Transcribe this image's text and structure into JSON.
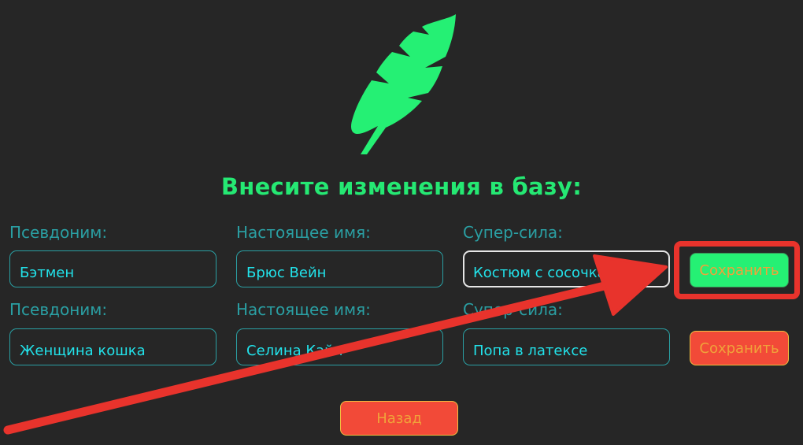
{
  "heading": "Внесите изменения в базу:",
  "rows": [
    {
      "alias_label": "Псевдоним:",
      "alias_value": "Бэтмен",
      "realname_label": "Настоящее имя:",
      "realname_value": "Брюс Вейн",
      "power_label": "Супер-сила:",
      "power_value": "Костюм с сосочками",
      "save_label": "Сохранить"
    },
    {
      "alias_label": "Псевдоним:",
      "alias_value": "Женщина кошка",
      "realname_label": "Настоящее имя:",
      "realname_value": "Селина Кайл",
      "power_label": "Супер-сила:",
      "power_value": "Попа в латексе",
      "save_label": "Сохранить"
    }
  ],
  "back_label": "Назад",
  "colors": {
    "background": "#262626",
    "accent_green": "#25e873",
    "label_teal": "#2a9fa3",
    "input_text": "#22e2ea",
    "button_red": "#f24a38",
    "button_text": "#f0a23a",
    "annotation_red": "#e8332c"
  },
  "icons": {
    "logo": "leaf-icon",
    "annotation": "red-arrow"
  }
}
